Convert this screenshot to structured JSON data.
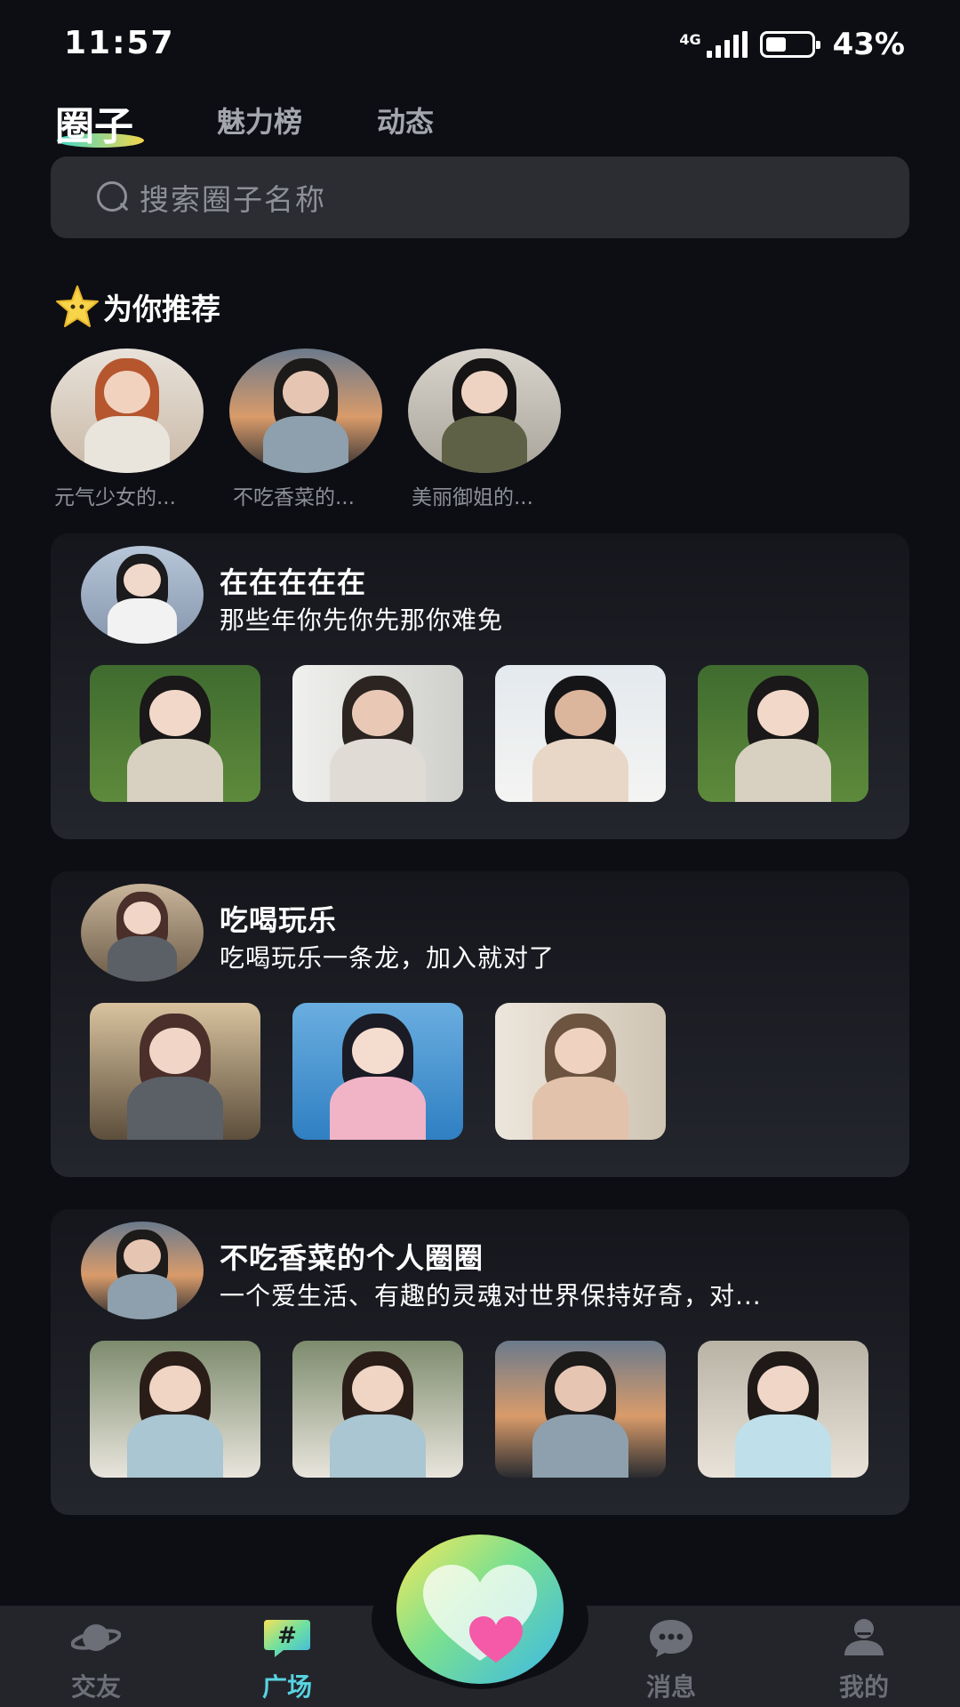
{
  "status_bar": {
    "time": "11:57",
    "network": "4G",
    "battery_percent": "43%",
    "battery_level": 0.43
  },
  "top_nav": {
    "logo_label": "圈子",
    "tabs": [
      "魅力榜",
      "动态"
    ]
  },
  "search": {
    "placeholder": "搜索圈子名称"
  },
  "recommend": {
    "title": "为你推荐",
    "items": [
      {
        "label": "元气少女的..."
      },
      {
        "label": "不吃香菜的..."
      },
      {
        "label": "美丽御姐的..."
      }
    ]
  },
  "circles": [
    {
      "name": "在在在在在",
      "description": "那些年你先你先那你难免"
    },
    {
      "name": "吃喝玩乐",
      "description": "吃喝玩乐一条龙，加入就对了"
    },
    {
      "name": "不吃香菜的个人圈圈",
      "description": "一个爱生活、有趣的灵魂对世界保持好奇，对..."
    }
  ],
  "bottom_nav": {
    "items": [
      {
        "label": "交友",
        "icon": "planet-icon"
      },
      {
        "label": "广场",
        "icon": "hashtag-icon",
        "active": true
      },
      {
        "label": "消息",
        "icon": "chat-bubble-icon"
      },
      {
        "label": "我的",
        "icon": "person-icon"
      }
    ],
    "center_icon": "heart-icon"
  },
  "colors": {
    "background": "#0d0e13",
    "accent": "#58d3e0",
    "inactive": "#6c6f77",
    "card_bg": "#24262d"
  }
}
